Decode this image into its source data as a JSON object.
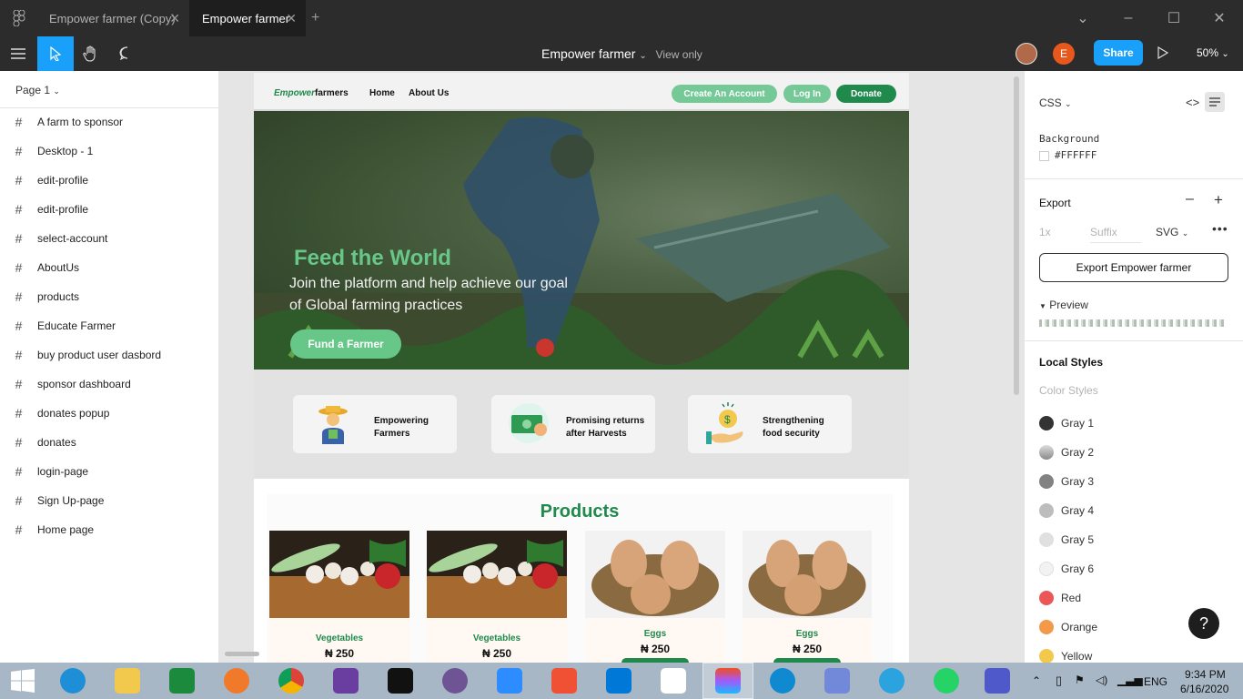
{
  "titlebar": {
    "tabs": [
      {
        "label": "Empower farmer (Copy)"
      },
      {
        "label": "Empower farmer"
      }
    ],
    "new_tab": "+"
  },
  "toolbar": {
    "doc_title": "Empower farmer",
    "view_mode": "View only",
    "share_label": "Share",
    "zoom": "50%",
    "avatar_letter": "E"
  },
  "left_panel": {
    "page": "Page 1",
    "layers": [
      "A farm to sponsor",
      "Desktop - 1",
      "edit-profile",
      "edit-profile",
      "select-account",
      "AboutUs",
      "products",
      "Educate Farmer",
      "buy product user dasbord",
      "sponsor dashboard",
      "donates popup",
      "donates",
      "login-page",
      "Sign Up-page",
      "Home page"
    ]
  },
  "design": {
    "nav": {
      "brand_em": "Empower",
      "brand_rest": "farmers",
      "links": [
        "Home",
        "About Us"
      ],
      "create_account": "Create An Account",
      "login": "Log In",
      "donate": "Donate"
    },
    "hero": {
      "title": "Feed the World",
      "subtitle": "Join the platform and help achieve our goal of Global farming practices",
      "cta": "Fund a Farmer"
    },
    "features": [
      {
        "text": "Empowering Farmers",
        "icon": "farmer-icon"
      },
      {
        "text": "Promising returns after Harvests",
        "icon": "money-icon"
      },
      {
        "text": "Strengthening food security",
        "icon": "coin-hand-icon"
      }
    ],
    "products": {
      "title": "Products",
      "items": [
        {
          "name": "Vegetables",
          "price": "₦ 250"
        },
        {
          "name": "Vegetables",
          "price": "₦ 250"
        },
        {
          "name": "Eggs",
          "price": "₦ 250"
        },
        {
          "name": "Eggs",
          "price": "₦ 250"
        }
      ]
    }
  },
  "right_panel": {
    "code_lang": "CSS",
    "background_label": "Background",
    "background_value": "#FFFFFF",
    "export_label": "Export",
    "scale": "1x",
    "suffix_placeholder": "Suffix",
    "format": "SVG",
    "export_button": "Export Empower farmer",
    "preview_label": "Preview",
    "local_styles": "Local Styles",
    "color_styles": "Color Styles",
    "styles": [
      {
        "name": "Gray 1",
        "color": "#333333"
      },
      {
        "name": "Gray 2",
        "color": "#8a8a8a"
      },
      {
        "name": "Gray 3",
        "color": "#828282"
      },
      {
        "name": "Gray 4",
        "color": "#bdbdbd"
      },
      {
        "name": "Gray 5",
        "color": "#e0e0e0"
      },
      {
        "name": "Gray 6",
        "color": "#f2f2f2"
      },
      {
        "name": "Red",
        "color": "#eb5757"
      },
      {
        "name": "Orange",
        "color": "#f2994a"
      },
      {
        "name": "Yellow",
        "color": "#f2c94c"
      }
    ]
  },
  "taskbar": {
    "lang": "ENG",
    "time": "9:34 PM",
    "date": "6/16/2020"
  }
}
